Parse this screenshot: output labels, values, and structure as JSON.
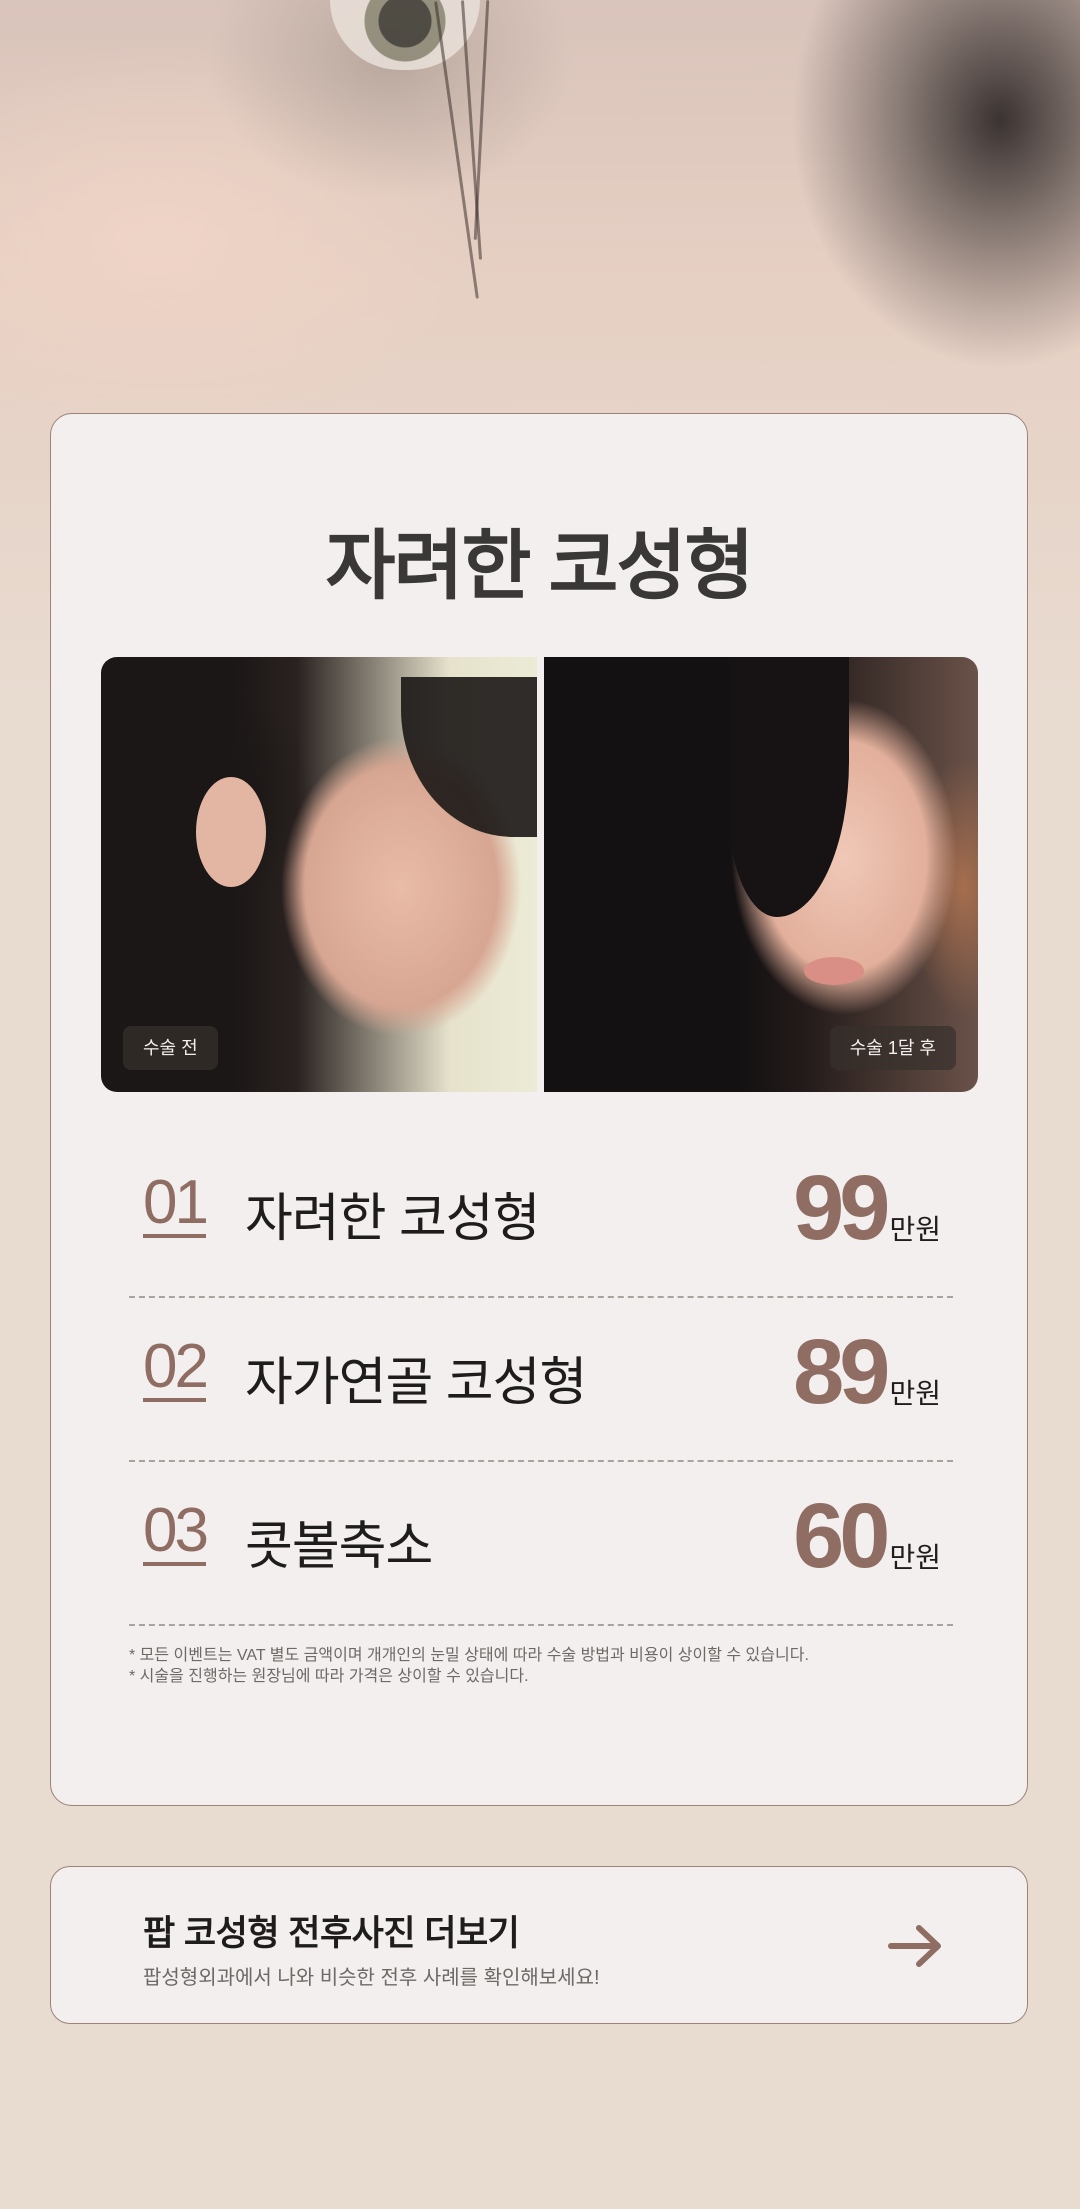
{
  "event": {
    "title": "자려한 코성형",
    "photos": {
      "before_label": "수술 전",
      "after_label": "수술 1달 후"
    },
    "items": [
      {
        "num": "01",
        "name": "자려한 코성형",
        "price": "99",
        "unit": "만원"
      },
      {
        "num": "02",
        "name": "자가연골 코성형",
        "price": "89",
        "unit": "만원"
      },
      {
        "num": "03",
        "name": "콧볼축소",
        "price": "60",
        "unit": "만원"
      }
    ],
    "notes": [
      "* 모든 이벤트는 VAT 별도 금액이며 개개인의 눈밀 상태에 따라 수술 방법과 비용이 상이할 수 있습니다.",
      "* 시술을 진행하는 원장님에 따라 가격은 상이할 수 있습니다."
    ]
  },
  "more": {
    "title": "팝 코성형 전후사진 더보기",
    "subtitle": "팝성형외과에서 나와 비슷한 전후 사례를 확인해보세요!",
    "icon": "arrow-right-icon"
  },
  "colors": {
    "accent": "#8f6d63",
    "card_bg": "#f2efee",
    "page_bg": "#e8dbd0"
  }
}
